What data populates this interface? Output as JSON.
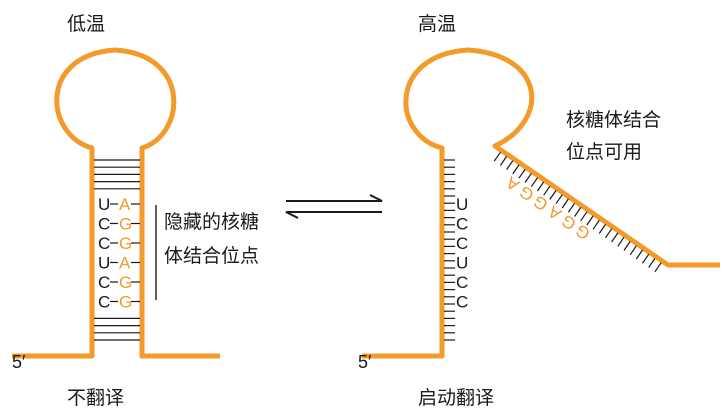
{
  "colors": {
    "rna": "#F39A2B",
    "text": "#1a1a1a",
    "line": "#1a1a1a"
  },
  "left": {
    "title": "低温",
    "hidden_label_line1": "隐藏的核糖",
    "hidden_label_line2": "体结合位点",
    "prime_label": "5′",
    "caption": "不翻译",
    "pairs": [
      {
        "left": "U",
        "right": "A"
      },
      {
        "left": "C",
        "right": "G"
      },
      {
        "left": "C",
        "right": "G"
      },
      {
        "left": "U",
        "right": "A"
      },
      {
        "left": "C",
        "right": "G"
      },
      {
        "left": "C",
        "right": "G"
      }
    ]
  },
  "right": {
    "title": "高温",
    "site_label_line1": "核糖体结合",
    "site_label_line2": "位点可用",
    "prime_label": "5′",
    "caption": "启动翻译",
    "stem_bases": [
      "U",
      "C",
      "C",
      "U",
      "C",
      "C"
    ],
    "tail_bases": [
      "A",
      "G",
      "G",
      "A",
      "G",
      "G"
    ]
  }
}
